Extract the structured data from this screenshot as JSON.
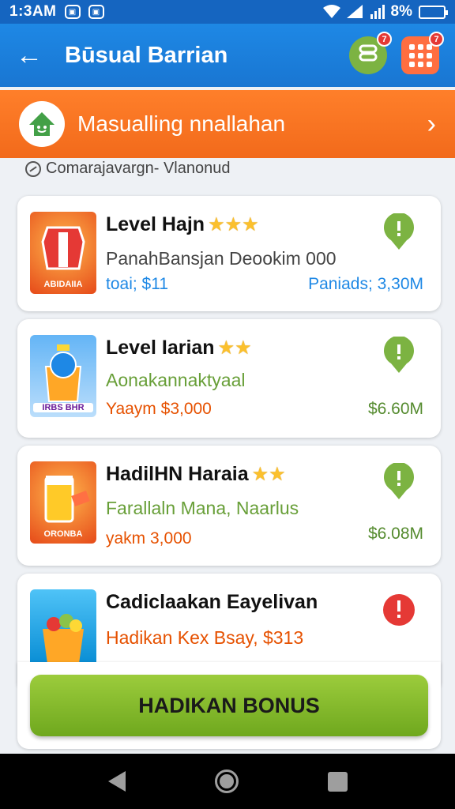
{
  "status_bar": {
    "time": "1:3AM",
    "battery": "8%"
  },
  "app_bar": {
    "title": "Būsual Barrian",
    "back_icon": "arrow-left-icon",
    "badge1": "7",
    "badge2": "7"
  },
  "banner": {
    "text": "Masualling nnallahan",
    "icon": "home-icon"
  },
  "section_label": "Comarajavargn- Vlanonud",
  "cards": [
    {
      "title": "Level Hajn",
      "stars": "★★★",
      "subtitle": "PanahBansjan Deookim 000",
      "price": "toai; $11",
      "amount": "Paniads; 3,30M",
      "thumb_caption": "ABIDAIIA",
      "sub_color": "#444444",
      "price_color": "#1e88e5",
      "amount_color": "#1e88e5",
      "status_color": "#7cb342"
    },
    {
      "title": "Level Iarian",
      "stars": "★★",
      "subtitle": "Aonakannaktyaal",
      "price": "Yaaym $3,000",
      "amount": "$6.60M",
      "thumb_caption": "IRBS BHR",
      "sub_color": "#689f38",
      "price_color": "#e65100",
      "amount_color": "#558b2f",
      "status_color": "#7cb342"
    },
    {
      "title": "HadilHN Haraia",
      "stars": "★★",
      "subtitle": "Farallaln Mana, Naarlus",
      "price": "yakm 3,000",
      "amount": "$6.08M",
      "thumb_caption": "ORONBA",
      "sub_color": "#689f38",
      "price_color": "#e65100",
      "amount_color": "#558b2f",
      "status_color": "#7cb342"
    },
    {
      "title": "Cadiclaakan Eayelivan",
      "stars": "",
      "subtitle": "Hadikan Kex Bsay, $313",
      "price": "",
      "amount": "",
      "thumb_caption": "",
      "sub_color": "#e65100",
      "price_color": "#e65100",
      "amount_color": "#558b2f",
      "status_color": "#e53935"
    }
  ],
  "cta": {
    "label": "HADIKAN BONUS"
  }
}
